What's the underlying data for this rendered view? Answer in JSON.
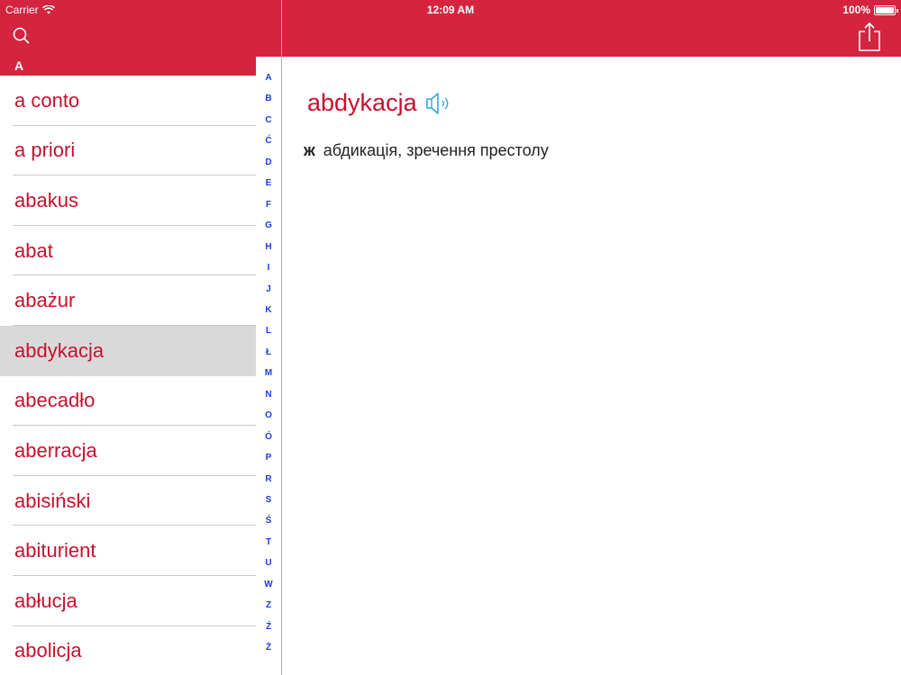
{
  "status_bar": {
    "carrier": "Carrier",
    "time": "12:09 AM",
    "battery": "100%"
  },
  "sidebar": {
    "section_header": "A",
    "items": [
      {
        "label": "a conto",
        "selected": false
      },
      {
        "label": "a priori",
        "selected": false
      },
      {
        "label": "abakus",
        "selected": false
      },
      {
        "label": "abat",
        "selected": false
      },
      {
        "label": "abażur",
        "selected": false
      },
      {
        "label": "abdykacja",
        "selected": true
      },
      {
        "label": "abecadło",
        "selected": false
      },
      {
        "label": "aberracja",
        "selected": false
      },
      {
        "label": "abisiński",
        "selected": false
      },
      {
        "label": "abiturient",
        "selected": false
      },
      {
        "label": "abłucja",
        "selected": false
      },
      {
        "label": "abolicja",
        "selected": false
      }
    ],
    "index": [
      "A",
      "B",
      "C",
      "Ć",
      "D",
      "E",
      "F",
      "G",
      "H",
      "I",
      "J",
      "K",
      "L",
      "Ł",
      "M",
      "N",
      "O",
      "Ó",
      "P",
      "R",
      "S",
      "Ś",
      "T",
      "U",
      "W",
      "Z",
      "Ź",
      "Ż"
    ]
  },
  "entry": {
    "word": "abdykacja",
    "gender": "ж",
    "definition": "абдикація, зречення престолу"
  },
  "icons": {
    "search": "search-icon",
    "share": "share-icon",
    "speaker": "speaker-icon",
    "wifi": "wifi-icon",
    "battery": "battery-icon"
  },
  "colors": {
    "header": "#d42440",
    "word": "#c8102e",
    "index": "#1a3ce0",
    "selected_row": "#d9d9d9"
  }
}
